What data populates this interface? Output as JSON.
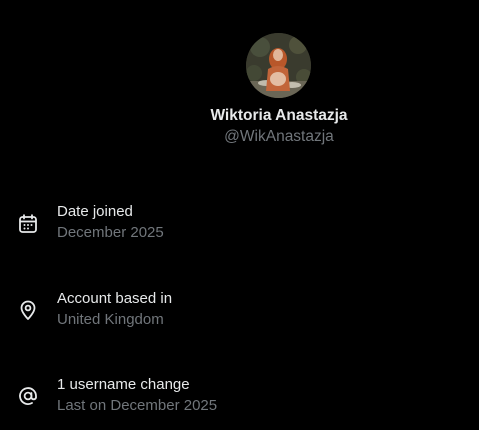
{
  "profile": {
    "display_name": "Wiktoria Anastazja",
    "handle": "@WikAnastazja"
  },
  "rows": [
    {
      "icon": "calendar-icon",
      "label": "Date joined",
      "value": "December 2025"
    },
    {
      "icon": "location-pin-icon",
      "label": "Account based in",
      "value": "United Kingdom"
    },
    {
      "icon": "at-sign-icon",
      "label": "1 username change",
      "value": "Last on December 2025"
    }
  ],
  "colors": {
    "background": "#000000",
    "primary_text": "#e7e9ea",
    "secondary_text": "#71767b"
  }
}
